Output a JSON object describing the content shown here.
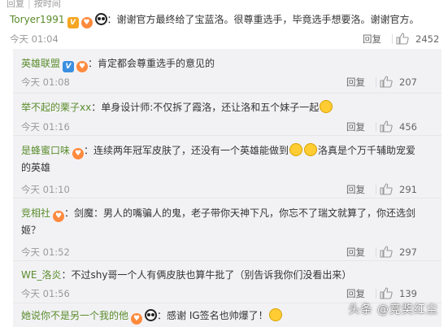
{
  "top": {
    "left": "回复",
    "right": "按时间"
  },
  "main": {
    "username": "Toryer1991",
    "colon": "：",
    "text": "谢谢官方最终给了宝蓝洛。很尊重选手，毕竟选手想要洛。谢谢官方。",
    "time": "今天 01:04",
    "reply": "回复",
    "likes": "2452"
  },
  "replies": [
    {
      "username": "英雄联盟",
      "colon": "：",
      "text": "肯定都会尊重选手的意见的",
      "time": "今天 01:08",
      "reply": "回复",
      "likes": "207"
    },
    {
      "username": "举不起的栗子xx",
      "colon": "：",
      "text": "单身设计师:不仅拆了霞洛，还让洛和五个妹子一起",
      "time": "今天 01:16",
      "reply": "回复",
      "likes": "456"
    },
    {
      "username": "是蜂蜜口味",
      "colon": "：",
      "text_a": "连续两年冠军皮肤了，还没有一个英雄能做到",
      "text_b": "洛真是个万千辅助宠爱",
      "text_c": "的英雄",
      "time": "今天 01:10",
      "reply": "回复",
      "likes": "291"
    },
    {
      "username": "竞相社",
      "colon": "：",
      "text_a": "剑魔：男人的嘴骗人的鬼，老子带你天神下凡，你忘不了瑞文就算了，你还选剑",
      "text_b": "姬？",
      "time": "今天 01:52",
      "reply": "回复",
      "likes": "297"
    },
    {
      "username": "WE_洛炎",
      "colon": "：",
      "text": "不过shy哥一个人有俩皮肤也算牛批了（别告诉我你们没看出来）",
      "time": "今天 01:56",
      "reply": "回复",
      "likes": "139"
    },
    {
      "username": "她说你不是另一个我的他",
      "colon": "：",
      "text": "感谢 IG签名也帅爆了！"
    }
  ],
  "watermark": "头条 @竞奖红尘",
  "colors": {
    "username": "#5a8c2b",
    "meta": "#999999",
    "sub_bg": "#f2f2f5"
  }
}
